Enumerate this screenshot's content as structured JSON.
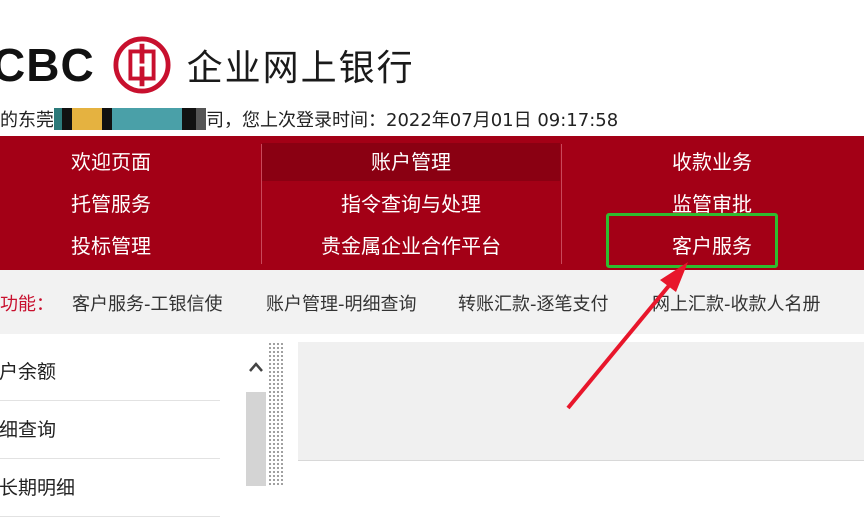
{
  "header": {
    "brand_abbr": "CBC",
    "brand_name": "企业网上银行",
    "welcome_prefix": "的东莞",
    "welcome_suffix": "司，您上次登录时间：2022年07月01日 09:17:58"
  },
  "nav": {
    "items": [
      {
        "label": "欢迎页面"
      },
      {
        "label": "账户管理"
      },
      {
        "label": "收款业务"
      },
      {
        "label": "托管服务"
      },
      {
        "label": "指令查询与处理"
      },
      {
        "label": "监管审批"
      },
      {
        "label": "投标管理"
      },
      {
        "label": "贵金属企业合作平台"
      },
      {
        "label": "客户服务"
      }
    ]
  },
  "quick": {
    "title": "功能：",
    "links": [
      {
        "label": "客户服务-工银信使"
      },
      {
        "label": "账户管理-明细查询"
      },
      {
        "label": "转账汇款-逐笔支付"
      },
      {
        "label": "网上汇款-收款人名册"
      }
    ]
  },
  "sidebar": {
    "items": [
      {
        "label": "账户余额"
      },
      {
        "label": "明细查询"
      },
      {
        "label": "账长期明细"
      }
    ]
  },
  "colors": {
    "nav_red": "#a30016",
    "nav_active": "#8a0012",
    "highlight_green": "#2fbd2f",
    "arrow_red": "#e8162b"
  },
  "icons": {
    "logo": "icbc-logo-icon",
    "scroll_up": "chevron-up-icon"
  }
}
